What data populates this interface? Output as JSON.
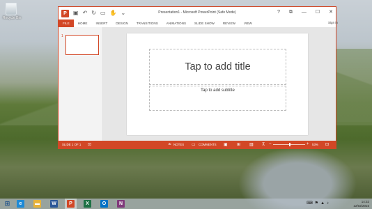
{
  "desktop": {
    "recycle_bin_label": "Recycle Bin"
  },
  "window": {
    "title": "Presentation1 - Microsoft PowerPoint (Safe Mode)",
    "app_icon_letter": "P",
    "quick_access": [
      "save-icon",
      "undo-icon",
      "redo-icon",
      "present-icon",
      "touch-mode-icon",
      "customize-icon"
    ],
    "controls": {
      "help": "?",
      "ribbon_display": "⧉",
      "minimize": "—",
      "maximize": "☐",
      "close": "✕"
    }
  },
  "ribbon": {
    "file_tab": "FILE",
    "tabs": [
      "HOME",
      "INSERT",
      "DESIGN",
      "TRANSITIONS",
      "ANIMATIONS",
      "SLIDE SHOW",
      "REVIEW",
      "VIEW"
    ],
    "sign_in": "Sign in"
  },
  "thumbnails": {
    "slide_number": "1"
  },
  "slide": {
    "title_placeholder": "Tap to add title",
    "subtitle_placeholder": "Tap to add subtitle"
  },
  "status": {
    "slide_info": "SLIDE 1 OF 1",
    "notes": "NOTES",
    "comments": "COMMENTS",
    "zoom_minus": "−",
    "zoom_plus": "+",
    "zoom_level": "53%",
    "zoom_fraction": 0.53
  },
  "taskbar": {
    "apps": [
      {
        "name": "ie-icon",
        "glyph": "e",
        "color": "#1e8ad6"
      },
      {
        "name": "file-explorer-icon",
        "glyph": "▬",
        "color": "#e8b33a"
      },
      {
        "name": "word-icon",
        "glyph": "W",
        "color": "#2b5797"
      },
      {
        "name": "powerpoint-icon",
        "glyph": "P",
        "color": "#d24726"
      },
      {
        "name": "excel-icon",
        "glyph": "X",
        "color": "#1e7145"
      },
      {
        "name": "outlook-icon",
        "glyph": "O",
        "color": "#0072c6"
      },
      {
        "name": "onenote-icon",
        "glyph": "N",
        "color": "#80397b"
      }
    ],
    "time": "14:32",
    "date": "22/02/2015"
  }
}
